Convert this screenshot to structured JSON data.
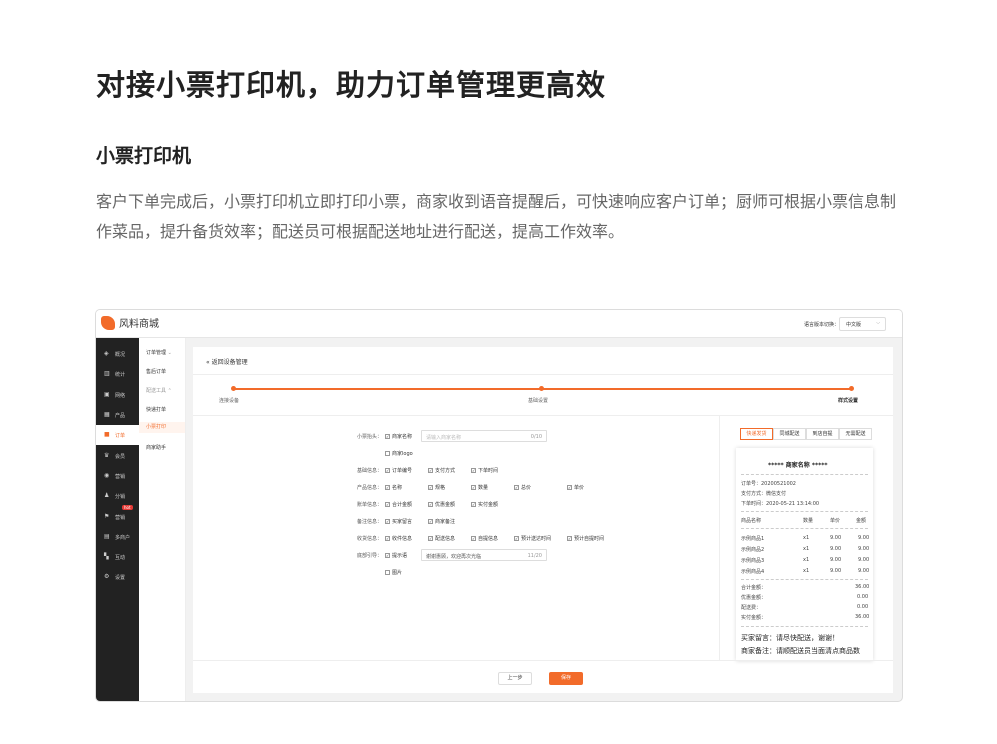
{
  "headline": "对接小票打印机，助力订单管理更高效",
  "subheading": "小票打印机",
  "description": "客户下单完成后，小票打印机立即打印小票，商家收到语音提醒后，可快速响应客户订单；厨师可根据小票信息制作菜品，提升备货效率；配送员可根据配送地址进行配送，提高工作效率。",
  "app": {
    "logo_text": "风料商城",
    "lang_label": "语言版本切换：",
    "lang_value": "中文版"
  },
  "sidebar": {
    "items": [
      {
        "label": "概况",
        "icon": "layers-icon"
      },
      {
        "label": "统计",
        "icon": "chart-icon"
      },
      {
        "label": "网络",
        "icon": "shop-icon"
      },
      {
        "label": "产品",
        "icon": "grid-icon"
      },
      {
        "label": "订单",
        "icon": "order-icon"
      },
      {
        "label": "会员",
        "icon": "crown-icon"
      },
      {
        "label": "营销",
        "icon": "gift-icon"
      },
      {
        "label": "分销",
        "icon": "user-icon"
      },
      {
        "label": "营销",
        "icon": "flag-icon"
      },
      {
        "label": "多商户",
        "icon": "store-icon"
      },
      {
        "label": "互动",
        "icon": "apps-icon"
      },
      {
        "label": "设置",
        "icon": "gear-icon"
      }
    ],
    "hot_badge": "hot"
  },
  "subnav": {
    "items": [
      "订单管理",
      "售后订单",
      "配送工具",
      "快递打单",
      "小票打印",
      "商家助手"
    ]
  },
  "page": {
    "back_label": "返回设备管理",
    "steps": [
      "连接设备",
      "基础设置",
      "样式设置"
    ]
  },
  "form": {
    "header_label": "小票抬头：",
    "merchant_name_opt": "商家名称",
    "merchant_name_placeholder": "请输入商家名称",
    "merchant_name_count": "0/10",
    "merchant_logo_opt": "商家logo",
    "basic_label": "基础信息：",
    "basic_opts": [
      "订单编号",
      "支付方式",
      "下单时间"
    ],
    "product_label": "产品信息：",
    "product_opts": [
      "名称",
      "规格",
      "数量",
      "总价",
      "单价"
    ],
    "bill_label": "账单信息：",
    "bill_opts": [
      "合计金额",
      "优惠金额",
      "实付金额"
    ],
    "remark_label": "备注信息：",
    "remark_opts": [
      "买家留言",
      "商家备注"
    ],
    "receiver_label": "收货信息：",
    "receiver_opts": [
      "收件信息",
      "配送信息",
      "自提信息",
      "预计送达时间",
      "预计自提时间"
    ],
    "footer_label": "底部引导：",
    "footer_opt": "提示语",
    "footer_value": "谢谢惠顾，欢迎再次光临",
    "footer_count": "11/20",
    "image_opt": "图片"
  },
  "preview": {
    "tabs": [
      "快递发货",
      "同城配送",
      "到店自提",
      "无需配送"
    ],
    "title": "***** 商家名称 *****",
    "order_no": "订单号：20200521002",
    "pay_method": "支付方式：微信支付",
    "order_time": "下单时间：2020-05-21 13:14:00",
    "table_head": [
      "商品名称",
      "数量",
      "单价",
      "金额"
    ],
    "items": [
      [
        "示例商品1",
        "x1",
        "9.00",
        "9.00"
      ],
      [
        "示例商品2",
        "x1",
        "9.00",
        "9.00"
      ],
      [
        "示例商品3",
        "x1",
        "9.00",
        "9.00"
      ],
      [
        "示例商品4",
        "x1",
        "9.00",
        "9.00"
      ]
    ],
    "totals": [
      [
        "合计金额：",
        "36.00"
      ],
      [
        "优惠金额：",
        "0.00"
      ],
      [
        "配送费：",
        "0.00"
      ],
      [
        "实付金额：",
        "36.00"
      ]
    ],
    "buyer_msg": "买家留言：请尽快配送，谢谢！",
    "seller_note": "商家备注：请顺配送员当面清点商品数"
  },
  "buttons": {
    "prev": "上一步",
    "save": "保存"
  },
  "colors": {
    "accent": "#f26b2a",
    "sidebar_bg": "#222222"
  }
}
